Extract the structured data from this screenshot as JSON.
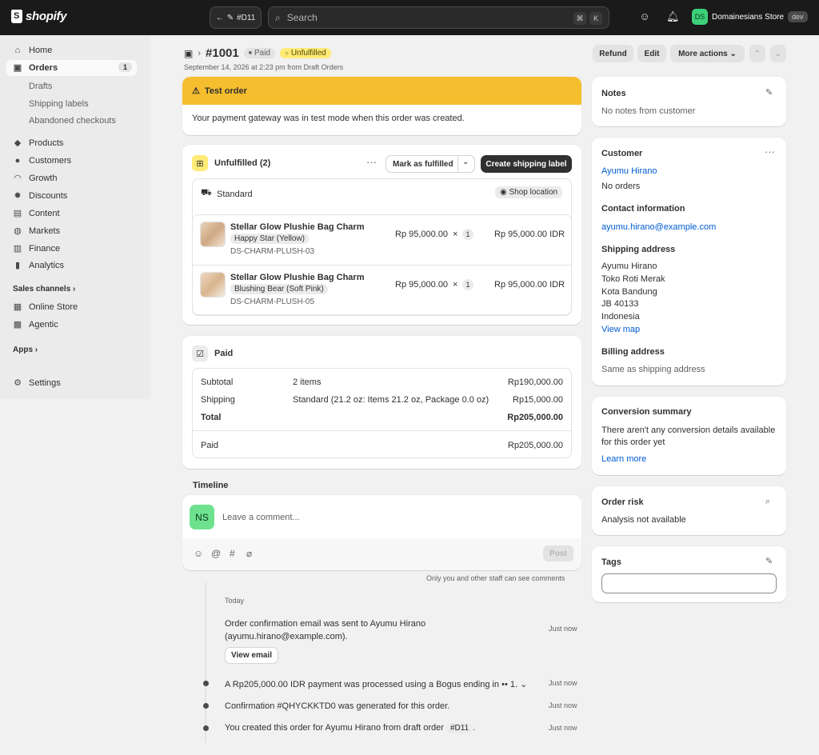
{
  "topbar": {
    "logo": "shopify",
    "nav_label": "#D11",
    "search_placeholder": "Search",
    "kbd": [
      "⌘",
      "K"
    ],
    "store_initials": "DS",
    "store_name": "Domainesians Store",
    "env_badge": "dev"
  },
  "sidebar": {
    "items": [
      {
        "label": "Home",
        "icon": "home-icon"
      },
      {
        "label": "Orders",
        "icon": "orders-icon",
        "count": "1"
      },
      {
        "label": "Products",
        "icon": "tag-icon"
      },
      {
        "label": "Customers",
        "icon": "person-icon"
      },
      {
        "label": "Growth",
        "icon": "gauge-icon"
      },
      {
        "label": "Discounts",
        "icon": "discount-icon"
      },
      {
        "label": "Content",
        "icon": "content-icon"
      },
      {
        "label": "Markets",
        "icon": "globe-icon"
      },
      {
        "label": "Finance",
        "icon": "bank-icon"
      },
      {
        "label": "Analytics",
        "icon": "chart-icon"
      },
      {
        "label": "Online Store",
        "icon": "store-icon"
      },
      {
        "label": "Agentic",
        "icon": "agentic-icon"
      },
      {
        "label": "Settings",
        "icon": "gear-icon"
      }
    ],
    "sub_items": [
      "Drafts",
      "Shipping labels",
      "Abandoned checkouts"
    ],
    "sales_channels": "Sales channels",
    "apps": "Apps"
  },
  "order": {
    "number": "#1001",
    "status_paid": "Paid",
    "status_fulfillment": "Unfulfilled",
    "subtitle": "September 14, 2026 at 2:23 pm from Draft Orders",
    "actions": {
      "refund": "Refund",
      "edit": "Edit",
      "more": "More actions"
    }
  },
  "test_order": {
    "title": "Test order",
    "message": "Your payment gateway was in test mode when this order was created."
  },
  "fulfillment": {
    "title": "Unfulfilled (2)",
    "mark_fulfilled": "Mark as fulfilled",
    "create_label": "Create shipping label",
    "method": "Standard",
    "location": "Shop location",
    "items": [
      {
        "name": "Stellar Glow Plushie Bag Charm",
        "variant": "Happy Star (Yellow)",
        "sku": "DS-CHARM-PLUSH-03",
        "price": "Rp 95,000.00",
        "times": "×",
        "qty": "1",
        "total": "Rp 95,000.00 IDR"
      },
      {
        "name": "Stellar Glow Plushie Bag Charm",
        "variant": "Blushing Bear (Soft Pink)",
        "sku": "DS-CHARM-PLUSH-05",
        "price": "Rp 95,000.00",
        "times": "×",
        "qty": "1",
        "total": "Rp 95,000.00 IDR"
      }
    ]
  },
  "payment": {
    "title": "Paid",
    "rows": [
      {
        "label": "Subtotal",
        "detail": "2 items",
        "amount": "Rp190,000.00"
      },
      {
        "label": "Shipping",
        "detail": "Standard (21.2 oz: Items 21.2 oz, Package 0.0 oz)",
        "amount": "Rp15,000.00"
      },
      {
        "label": "Total",
        "detail": "",
        "amount": "Rp205,000.00"
      }
    ],
    "paid_label": "Paid",
    "paid_amount": "Rp205,000.00"
  },
  "timeline": {
    "title": "Timeline",
    "avatar": "NS",
    "comment_placeholder": "Leave a comment...",
    "post": "Post",
    "staff_note": "Only you and other staff can see comments",
    "today": "Today",
    "events": [
      {
        "text": "Order confirmation email was sent to Ayumu Hirano (ayumu.hirano@example.com).",
        "time": "Just now",
        "button": "View email"
      },
      {
        "text": "A Rp205,000.00 IDR payment was processed using a Bogus ending in •• 1.",
        "time": "Just now"
      },
      {
        "text": "Confirmation #QHYCKKTD0 was generated for this order.",
        "time": "Just now"
      },
      {
        "text_before": "You created this order for Ayumu Hirano from draft order",
        "chip": "#D11",
        "text_after": ".",
        "time": "Just now"
      }
    ]
  },
  "notes": {
    "title": "Notes",
    "body": "No notes from customer"
  },
  "customer": {
    "title": "Customer",
    "name": "Ayumu Hirano",
    "orders": "No orders",
    "contact_title": "Contact information",
    "email": "ayumu.hirano@example.com",
    "shipping_title": "Shipping address",
    "address": [
      "Ayumu Hirano",
      "Toko Roti Merak",
      "Kota Bandung",
      "JB 40133",
      "Indonesia"
    ],
    "view_map": "View map",
    "billing_title": "Billing address",
    "billing_body": "Same as shipping address"
  },
  "conversion": {
    "title": "Conversion summary",
    "body": "There aren't any conversion details available for this order yet",
    "link": "Learn more"
  },
  "risk": {
    "title": "Order risk",
    "body": "Analysis not available"
  },
  "tags": {
    "title": "Tags",
    "placeholder": ""
  }
}
